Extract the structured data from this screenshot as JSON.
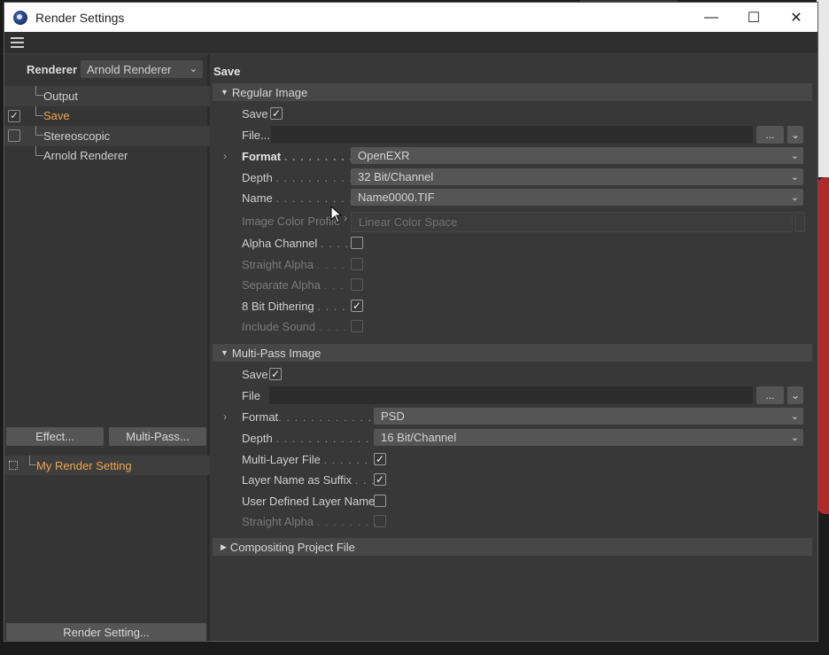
{
  "window": {
    "title": "Render Settings",
    "minimize": "—",
    "maximize": "☐",
    "close": "✕"
  },
  "left": {
    "renderer_label": "Renderer",
    "renderer_value": "Arnold Renderer",
    "tree": [
      {
        "label": "Output",
        "checkbox": false,
        "checked": false,
        "active": false
      },
      {
        "label": "Save",
        "checkbox": true,
        "checked": true,
        "active": true
      },
      {
        "label": "Stereoscopic",
        "checkbox": true,
        "checked": false,
        "active": false
      },
      {
        "label": "Arnold Renderer",
        "checkbox": false,
        "checked": false,
        "active": false
      }
    ],
    "effect_button": "Effect...",
    "multipass_button": "Multi-Pass...",
    "render_setting_name": "My Render Setting",
    "render_setting_button": "Render Setting..."
  },
  "right": {
    "section_title": "Save",
    "regular": {
      "header": "Regular Image",
      "save_label": "Save",
      "save_checked": true,
      "file_label": "File...",
      "file_button": "...",
      "format_label": "Format",
      "format_value": "OpenEXR",
      "depth_label": "Depth",
      "depth_value": "32 Bit/Channel",
      "name_label": "Name",
      "name_value": "Name0000.TIF",
      "color_profile_label": "Image Color Profile",
      "color_profile_value": "Linear Color Space",
      "alpha_label": "Alpha Channel",
      "alpha_checked": false,
      "straight_alpha_label": "Straight Alpha",
      "separate_alpha_label": "Separate Alpha",
      "dithering_label": "8 Bit Dithering",
      "dithering_checked": true,
      "sound_label": "Include Sound"
    },
    "multipass": {
      "header": "Multi-Pass Image",
      "save_label": "Save",
      "save_checked": true,
      "file_label": "File",
      "file_button": "...",
      "format_label": "Format",
      "format_value": "PSD",
      "depth_label": "Depth",
      "depth_value": "16 Bit/Channel",
      "multilayer_label": "Multi-Layer File",
      "multilayer_checked": true,
      "suffix_label": "Layer Name as Suffix",
      "suffix_checked": true,
      "user_defined_label": "User Defined Layer Name",
      "user_defined_checked": false,
      "straight_alpha_label": "Straight Alpha"
    },
    "compositing_header": "Compositing Project File"
  }
}
